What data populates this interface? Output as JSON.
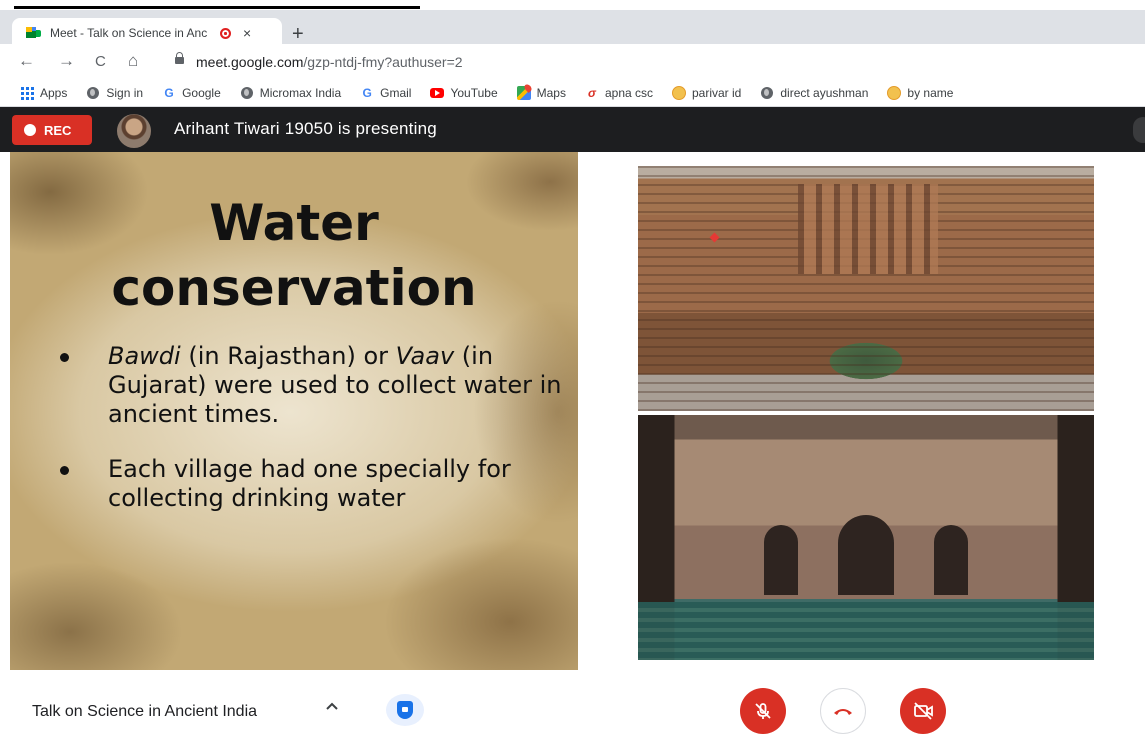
{
  "browser": {
    "tab_title": "Meet - Talk on Science in Anc",
    "tab_close": "×",
    "new_tab": "+",
    "url_host": "meet.google.com",
    "url_path": "/gzp-ntdj-fmy?authuser=2",
    "nav": {
      "back": "←",
      "forward": "→",
      "reload": "C",
      "home": "⌂"
    }
  },
  "bookmarks": [
    {
      "label": "Apps",
      "icon": "apps-grid-icon"
    },
    {
      "label": "Sign in",
      "icon": "globe-icon"
    },
    {
      "label": "Google",
      "icon": "google-icon"
    },
    {
      "label": "Micromax India",
      "icon": "globe-icon"
    },
    {
      "label": "Gmail",
      "icon": "google-icon"
    },
    {
      "label": "YouTube",
      "icon": "youtube-icon"
    },
    {
      "label": "Maps",
      "icon": "maps-icon"
    },
    {
      "label": "apna csc",
      "icon": "apna-csc-icon"
    },
    {
      "label": "parivar id",
      "icon": "face-icon"
    },
    {
      "label": "direct ayushman",
      "icon": "globe-icon"
    },
    {
      "label": "by name",
      "icon": "face-icon"
    }
  ],
  "meet": {
    "rec_label": "REC",
    "presenter_text": "Arihant Tiwari 19050 is presenting",
    "meeting_title": "Talk on Science in Ancient India",
    "chevron": "^"
  },
  "slide": {
    "title_line1": "Water",
    "title_line2": "conservation",
    "bullet1_em1": "Bawdi",
    "bullet1_t1": " (in Rajasthan) or ",
    "bullet1_em2": "Vaav",
    "bullet1_t2": " (in Gujarat) were used to collect water in ancient times.",
    "bullet2": "Each village had one specially for collecting drinking water"
  },
  "colors": {
    "rec_red": "#d93025",
    "meet_bar": "#1d1e20",
    "tabstrip": "#dee1e6"
  }
}
